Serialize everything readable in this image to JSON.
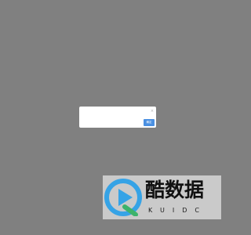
{
  "dialog": {
    "ok_label": "确定",
    "close_glyph": "×"
  },
  "watermark": {
    "title": "酷数据",
    "subtitle": "KUIDC"
  },
  "colors": {
    "backdrop": "#808080",
    "dialog_bg": "#ffffff",
    "button": "#4a90e2",
    "logo_blue": "#36a3e6",
    "logo_green": "#3db36b"
  },
  "icons": {
    "close": "close-icon",
    "logo": "kuidc-logo-icon"
  }
}
